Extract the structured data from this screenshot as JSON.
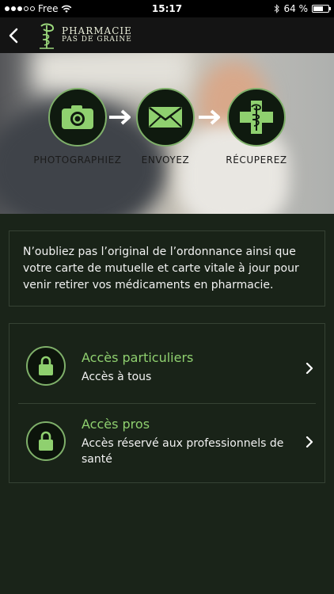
{
  "status_bar": {
    "carrier": "Free",
    "time": "15:17",
    "battery_text": "64 %",
    "battery_level": 0.64
  },
  "nav": {
    "back_icon": "chevron-left-icon",
    "logo_line1": "PHARMACIE",
    "logo_line2": "PAS DE GRAINE"
  },
  "hero": {
    "steps": [
      {
        "label": "PHOTOGRAPHIEZ",
        "icon": "camera-icon"
      },
      {
        "label": "ENVOYEZ",
        "icon": "envelope-icon"
      },
      {
        "label": "RÉCUPEREZ",
        "icon": "pharmacy-cross-icon"
      }
    ]
  },
  "info": {
    "text": "N’oubliez pas l’original de l’ordonnance ainsi que votre carte de mutuelle et carte vitale à jour pour venir retirer vos médicaments en pharmacie."
  },
  "access": [
    {
      "title": "Accès particuliers",
      "subtitle": "Accès à tous"
    },
    {
      "title": "Accès pros",
      "subtitle": "Accès réservé aux professionnels de santé"
    }
  ],
  "colors": {
    "accent": "#8fd06f",
    "background": "#1a2419",
    "icon_border": "#7fb06a"
  }
}
